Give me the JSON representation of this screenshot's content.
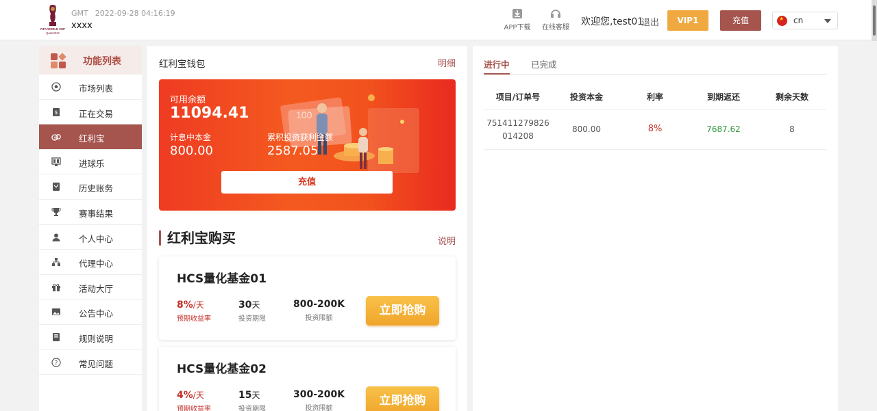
{
  "header": {
    "logo_text": "FIFA WORLD CUP Qatar2022",
    "gmt_label": "GMT",
    "datetime": "2022-09-28 04:16:19",
    "site_name": "xxxx",
    "app_download": "APP下载",
    "online_service": "在线客服",
    "welcome": "欢迎您,test01",
    "logout": "退出",
    "vip": "VIP1",
    "recharge": "充值",
    "lang": "cn"
  },
  "sidebar": {
    "title": "功能列表",
    "items": [
      {
        "label": "市场列表",
        "icon": "soccer-ball-icon"
      },
      {
        "label": "正在交易",
        "icon": "dollar-card-icon"
      },
      {
        "label": "红利宝",
        "icon": "coins-icon",
        "active": true
      },
      {
        "label": "进球乐",
        "icon": "scoreboard-icon"
      },
      {
        "label": "历史账务",
        "icon": "ledger-icon"
      },
      {
        "label": "赛事结果",
        "icon": "trophy-icon"
      },
      {
        "label": "个人中心",
        "icon": "user-icon"
      },
      {
        "label": "代理中心",
        "icon": "hierarchy-icon"
      },
      {
        "label": "活动大厅",
        "icon": "gift-icon"
      },
      {
        "label": "公告中心",
        "icon": "image-icon"
      },
      {
        "label": "规则说明",
        "icon": "book-icon"
      },
      {
        "label": "常见问题",
        "icon": "question-icon"
      }
    ]
  },
  "wallet": {
    "title": "红利宝钱包",
    "detail": "明细",
    "available_label": "可用余额",
    "available": "11094.41",
    "principal_label": "计息中本金",
    "principal": "800.00",
    "profit_label": "累积投资获利金额",
    "profit": "2587.05",
    "recharge_btn": "充值"
  },
  "buy": {
    "title": "红利宝购买",
    "explain": "说明",
    "funds": [
      {
        "name": "HCS量化基金01",
        "rate": "8%",
        "rate_unit": "/天",
        "rate_label": "预期收益率",
        "period": "30",
        "period_unit": "天",
        "period_label": "投资期限",
        "limit": "800-200K",
        "limit_label": "投资限额",
        "btn": "立即抢购"
      },
      {
        "name": "HCS量化基金02",
        "rate": "4%",
        "rate_unit": "/天",
        "rate_label": "预期收益率",
        "period": "15",
        "period_unit": "天",
        "period_label": "投资期限",
        "limit": "300-200K",
        "limit_label": "投资限额",
        "btn": "立即抢购"
      }
    ]
  },
  "orders": {
    "tabs": [
      "进行中",
      "已完成"
    ],
    "columns": [
      "项目/订单号",
      "投资本金",
      "利率",
      "到期返还",
      "剩余天数"
    ],
    "rows": [
      {
        "order_line1": "751411279826",
        "order_line2": "014208",
        "principal": "800.00",
        "rate": "8%",
        "return": "7687.62",
        "days_left": "8"
      }
    ]
  },
  "colors": {
    "brand": "#a5544e",
    "vip": "#f0a840",
    "card_red": "#ef3b22",
    "rate_red": "#c3302a",
    "return_green": "#2e9a3a",
    "grab_orange": "#f0a52a"
  }
}
